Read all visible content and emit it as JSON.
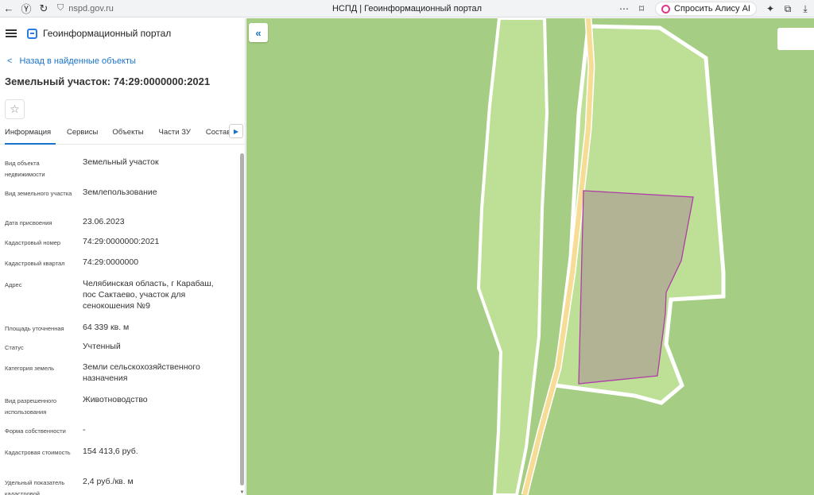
{
  "browser": {
    "url": "nspd.gov.ru",
    "tab_title": "НСПД | Геоинформационный портал",
    "alice_label": "Спросить Алису AI"
  },
  "portal": {
    "name": "Геоинформационный портал"
  },
  "panel": {
    "back_label": "Назад в найденные объекты",
    "title": "Земельный участок: 74:29:0000000:2021",
    "tabs": [
      "Информация",
      "Сервисы",
      "Объекты",
      "Части ЗУ",
      "Состав"
    ],
    "active_tab": "Информация",
    "properties": [
      {
        "label": "Вид объекта недвижимости",
        "value": "Земельный участок"
      },
      {
        "label": "Вид земельного участка",
        "value": "Землепользование"
      },
      {
        "label": "Дата присвоения",
        "value": "23.06.2023"
      },
      {
        "label": "Кадастровый номер",
        "value": "74:29:0000000:2021"
      },
      {
        "label": "Кадастровый квартал",
        "value": "74:29:0000000"
      },
      {
        "label": "Адрес",
        "value": "Челябинская область, г Карабаш, пос Сактаево, участок для сенокошения №9"
      },
      {
        "label": "Площадь уточненная",
        "value": "64 339 кв. м"
      },
      {
        "label": "Статус",
        "value": "Учтенный"
      },
      {
        "label": "Категория земель",
        "value": "Земли сельскохозяйственного назначения"
      },
      {
        "label": "Вид разрешенного использования",
        "value": "Животноводство"
      },
      {
        "label": "Форма собственности",
        "value": "-"
      },
      {
        "label": "Кадастровая стоимость",
        "value": "154 413,6 руб."
      },
      {
        "label": "Удельный показатель кадастровой",
        "value": "2,4 руб./кв. м"
      }
    ]
  },
  "map": {
    "colors": {
      "background": "#a5cd83",
      "field": "#bde096",
      "road": "#f7dc96",
      "parcel_fill": "#b2b395",
      "parcel_border": "#b03ca8",
      "boundary": "#ffffff"
    }
  }
}
